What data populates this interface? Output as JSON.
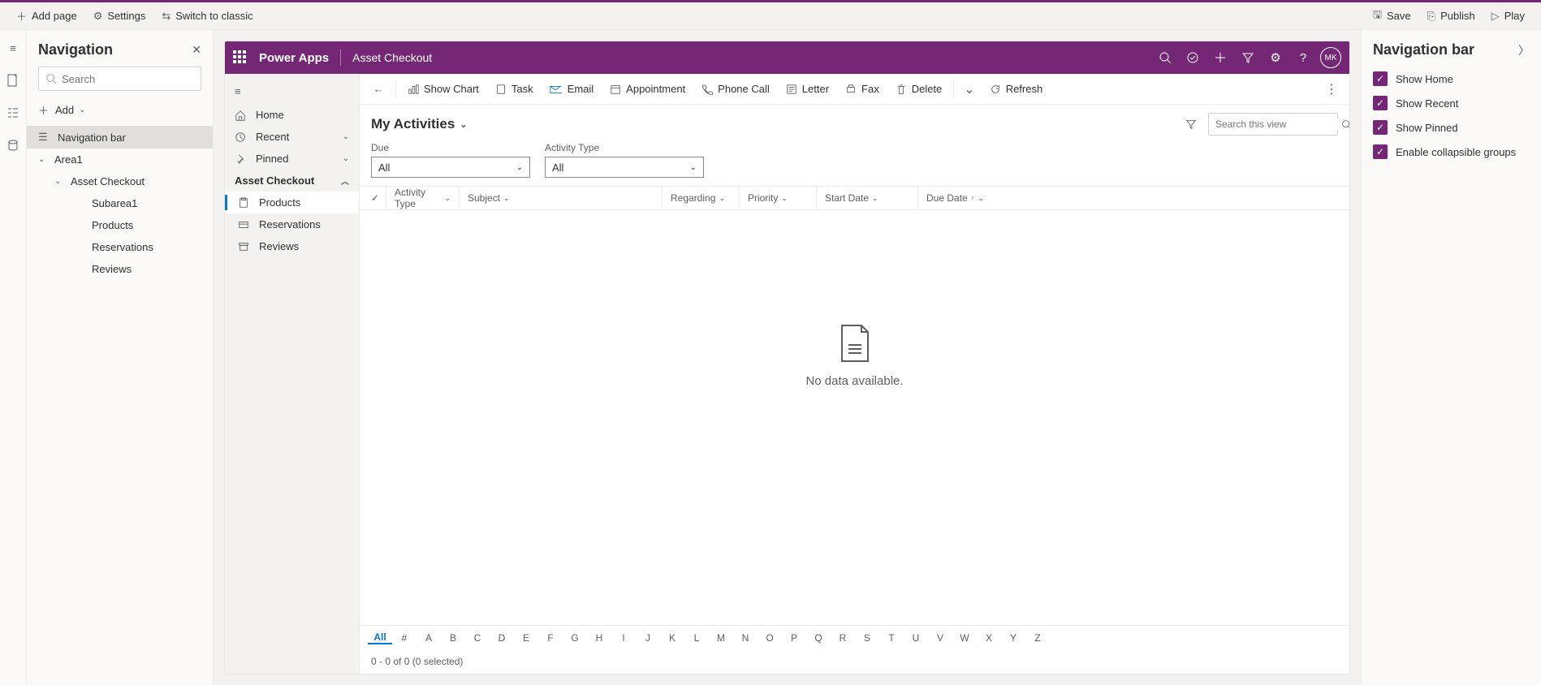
{
  "topbar": {
    "add_page": "Add page",
    "settings": "Settings",
    "switch": "Switch to classic",
    "save": "Save",
    "publish": "Publish",
    "play": "Play"
  },
  "nav_panel": {
    "title": "Navigation",
    "search_placeholder": "Search",
    "add": "Add",
    "items": {
      "navbar": "Navigation bar",
      "area1": "Area1",
      "asset_checkout": "Asset Checkout",
      "subarea1": "Subarea1",
      "products": "Products",
      "reservations": "Reservations",
      "reviews": "Reviews"
    }
  },
  "app_header": {
    "brand": "Power Apps",
    "app_name": "Asset Checkout",
    "avatar": "MK"
  },
  "sitemap": {
    "home": "Home",
    "recent": "Recent",
    "pinned": "Pinned",
    "group": "Asset Checkout",
    "products": "Products",
    "reservations": "Reservations",
    "reviews": "Reviews"
  },
  "cmdbar": {
    "show_chart": "Show Chart",
    "task": "Task",
    "email": "Email",
    "appointment": "Appointment",
    "phone": "Phone Call",
    "letter": "Letter",
    "fax": "Fax",
    "delete": "Delete",
    "refresh": "Refresh"
  },
  "view": {
    "title": "My Activities",
    "search_placeholder": "Search this view",
    "due_label": "Due",
    "due_value": "All",
    "activity_type_label": "Activity Type",
    "activity_type_value": "All",
    "cols": {
      "activity_type": "Activity Type",
      "subject": "Subject",
      "regarding": "Regarding",
      "priority": "Priority",
      "start_date": "Start Date",
      "due_date": "Due Date"
    },
    "empty_msg": "No data available.",
    "footer": "0 - 0 of 0 (0 selected)",
    "alpha_all": "All",
    "alpha": [
      "#",
      "A",
      "B",
      "C",
      "D",
      "E",
      "F",
      "G",
      "H",
      "I",
      "J",
      "K",
      "L",
      "M",
      "N",
      "O",
      "P",
      "Q",
      "R",
      "S",
      "T",
      "U",
      "V",
      "W",
      "X",
      "Y",
      "Z"
    ]
  },
  "prop_panel": {
    "title": "Navigation bar",
    "show_home": "Show Home",
    "show_recent": "Show Recent",
    "show_pinned": "Show Pinned",
    "enable_groups": "Enable collapsible groups"
  }
}
